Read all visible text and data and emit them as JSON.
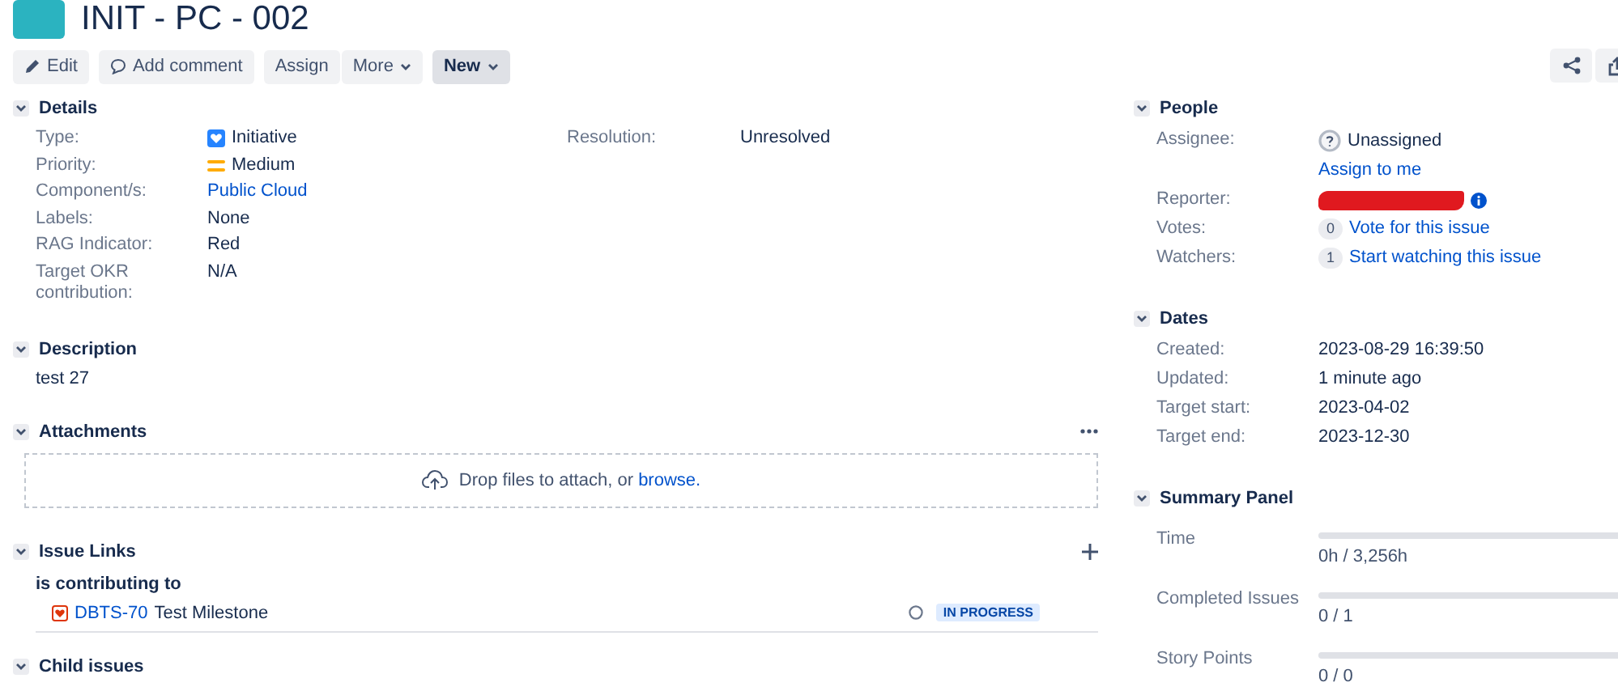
{
  "issue": {
    "title": "INIT - PC - 002"
  },
  "toolbar": [
    {
      "buttons": [
        {
          "label": "Edit",
          "kind": "edit"
        }
      ]
    },
    {
      "buttons": [
        {
          "label": "Add comment",
          "kind": "comment"
        }
      ]
    },
    {
      "buttons": [
        {
          "label": "Assign",
          "kind": "plain"
        },
        {
          "label": "More",
          "kind": "dropdown"
        }
      ]
    },
    {
      "buttons": [
        {
          "label": "New",
          "kind": "menu"
        }
      ]
    }
  ],
  "details": {
    "title": "Details",
    "expanded": true,
    "fields": [
      {
        "label": "Type:",
        "value": "Initiative",
        "kind": "type"
      },
      {
        "label": "Priority:",
        "value": "Medium",
        "kind": "priority"
      },
      {
        "label": "Component/s:",
        "value": "Public Cloud",
        "kind": "link"
      },
      {
        "label": "Labels:",
        "value": "None",
        "kind": "text"
      },
      {
        "label": "RAG Indicator:",
        "value": "Red",
        "kind": "text"
      },
      {
        "label": "Target OKR contribution:",
        "value": "N/A",
        "kind": "text"
      }
    ],
    "side_fields": [
      {
        "label": "Resolution:",
        "value": "Unresolved"
      }
    ]
  },
  "description": {
    "title": "Description",
    "expanded": true,
    "text": "test 27"
  },
  "attachments": {
    "title": "Attachments",
    "expanded": true,
    "drop_text": "Drop files to attach, or",
    "browse_link": "browse."
  },
  "issue_links": {
    "title": "Issue Links",
    "expanded": true,
    "relation": "is contributing to",
    "links": [
      {
        "key": "DBTS-70",
        "summary": "Test Milestone",
        "status": "IN PROGRESS"
      }
    ]
  },
  "child_issues": {
    "title": "Child issues",
    "expanded": true
  },
  "people": {
    "title": "People",
    "expanded": true,
    "fields": [
      {
        "label": "Assignee:",
        "kind": "avatar",
        "value": "Unassigned",
        "action": "Assign to me"
      },
      {
        "label": "Reporter:",
        "kind": "redacted"
      },
      {
        "label": "Votes:",
        "kind": "count",
        "count": "0",
        "value": "Vote for this issue"
      },
      {
        "label": "Watchers:",
        "kind": "count",
        "count": "1",
        "value": "Start watching this issue"
      }
    ]
  },
  "dates": {
    "title": "Dates",
    "expanded": true,
    "fields": [
      {
        "label": "Created:",
        "value": "2023-08-29 16:39:50"
      },
      {
        "label": "Updated:",
        "value": "1 minute ago"
      },
      {
        "label": "Target start:",
        "value": "2023-04-02"
      },
      {
        "label": "Target end:",
        "value": "2023-12-30"
      }
    ]
  },
  "summary_panel": {
    "title": "Summary Panel",
    "expanded": true,
    "items": [
      {
        "label": "Time",
        "value": "0h / 3,256h",
        "level": 0
      },
      {
        "label": "Completed Issues",
        "value": "0 / 1",
        "level": 0
      },
      {
        "label": "Story Points",
        "value": "0 / 0",
        "level": 0
      }
    ]
  }
}
